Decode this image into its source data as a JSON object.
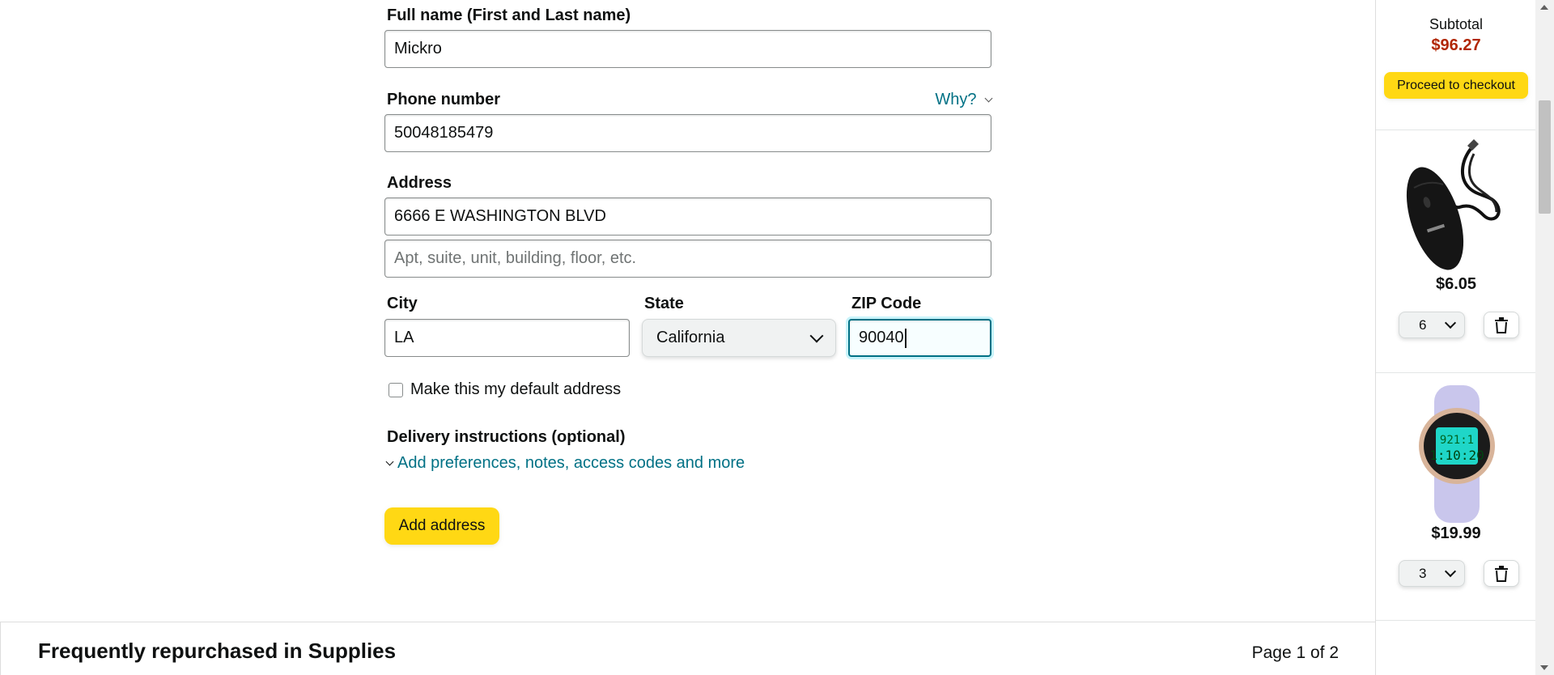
{
  "form": {
    "full_name_label": "Full name (First and Last name)",
    "full_name_value": "Mickro",
    "phone_label": "Phone number",
    "why_link": "Why?",
    "phone_value": "50048185479",
    "address_label": "Address",
    "address_line1_value": "6666 E WASHINGTON BLVD",
    "address_line2_placeholder": "Apt, suite, unit, building, floor, etc.",
    "city_label": "City",
    "city_value": "LA",
    "state_label": "State",
    "state_value": "California",
    "zip_label": "ZIP Code",
    "zip_value": "90040",
    "default_address_label": "Make this my default address",
    "default_address_checked": false,
    "delivery_label": "Delivery instructions (optional)",
    "delivery_link": "Add preferences, notes, access codes and more",
    "add_address_button": "Add address"
  },
  "carousel": {
    "title": "Frequently repurchased in Supplies",
    "page": "Page 1 of 2"
  },
  "cart_sidebar": {
    "subtotal_label": "Subtotal",
    "subtotal_value": "$96.27",
    "checkout_button": "Proceed to checkout",
    "items": [
      {
        "name": "mouse",
        "price": "$6.05",
        "qty": "6"
      },
      {
        "name": "watch",
        "price": "$19.99",
        "qty": "3"
      }
    ]
  },
  "colors": {
    "link": "#007185",
    "price_red": "#b12704",
    "button_yellow": "#ffd814",
    "focus_border": "#007185"
  }
}
